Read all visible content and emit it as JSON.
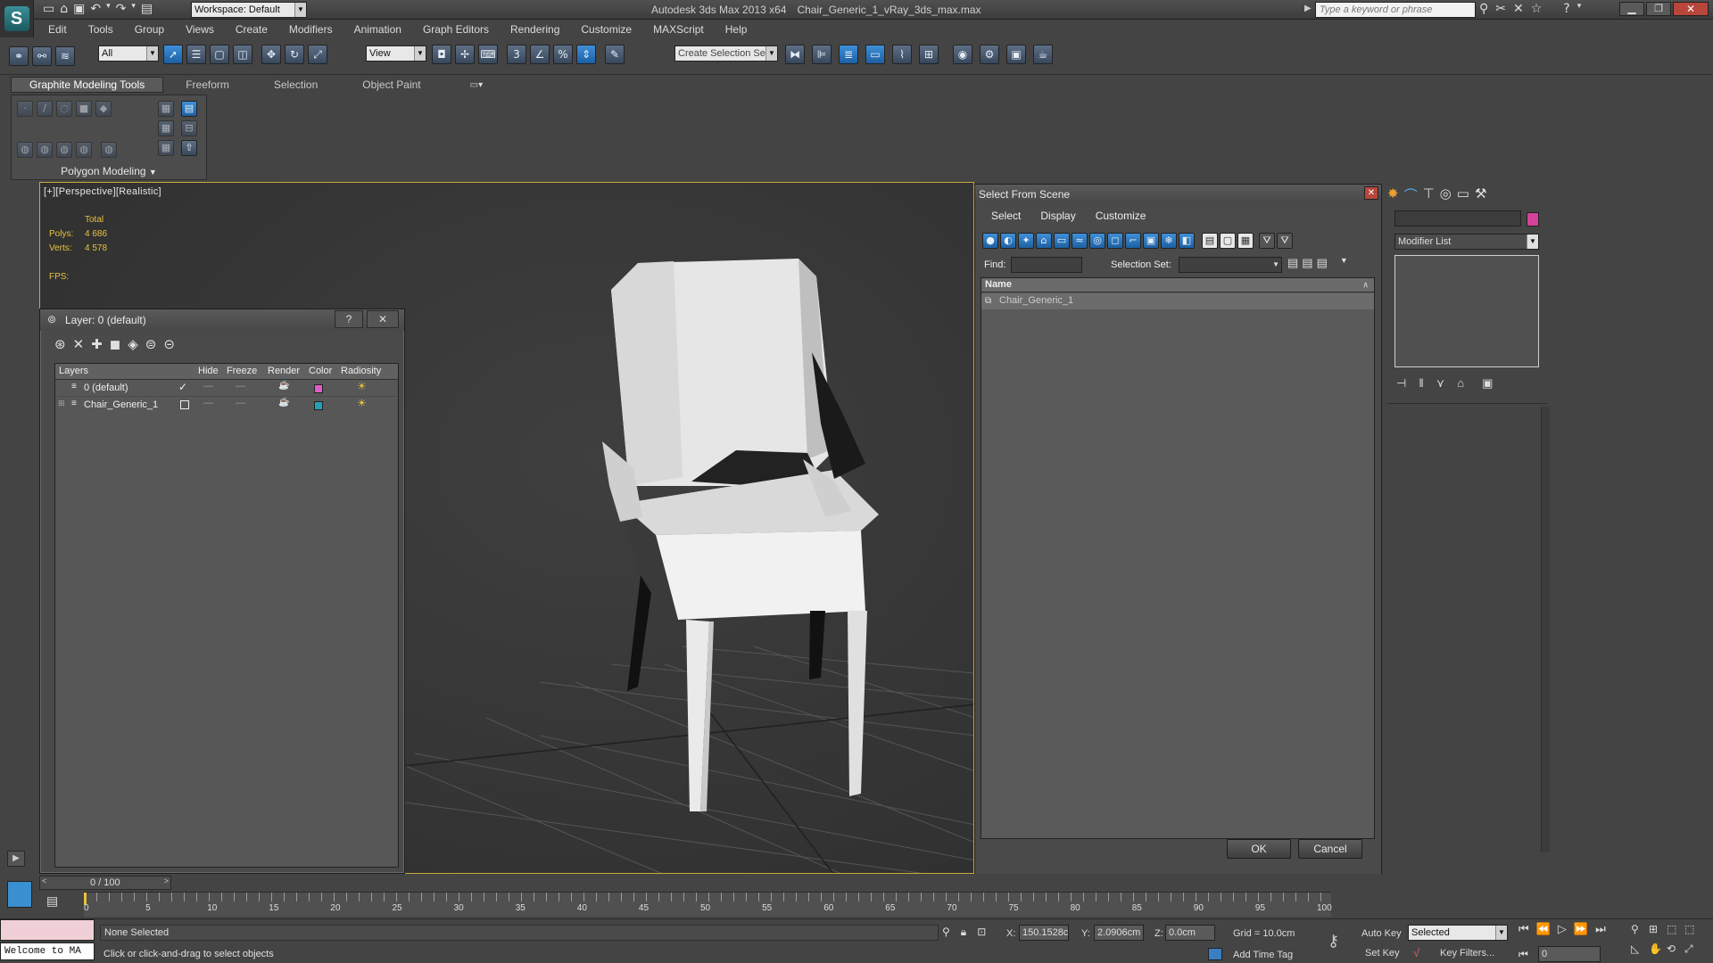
{
  "titlebar": {
    "workspace": "Workspace: Default",
    "app": "Autodesk 3ds Max  2013 x64",
    "file": "Chair_Generic_1_vRay_3ds_max.max",
    "search_placeholder": "Type a keyword or phrase"
  },
  "menu": [
    "Edit",
    "Tools",
    "Group",
    "Views",
    "Create",
    "Modifiers",
    "Animation",
    "Graph Editors",
    "Rendering",
    "Customize",
    "MAXScript",
    "Help"
  ],
  "toolbar": {
    "filter": "All",
    "refcoord": "View",
    "selset": "Create Selection Se"
  },
  "ribbon": {
    "tabs": [
      "Graphite Modeling Tools",
      "Freeform",
      "Selection",
      "Object Paint"
    ],
    "panel": "Polygon Modeling"
  },
  "viewport": {
    "label": "[+][Perspective][Realistic]",
    "stats": {
      "total": "Total",
      "polys_label": "Polys:",
      "polys": "4 686",
      "verts_label": "Verts:",
      "verts": "4 578",
      "fps_label": "FPS:"
    }
  },
  "layer_dialog": {
    "title": "Layer: 0 (default)",
    "help": "?",
    "columns": [
      "Layers",
      "Hide",
      "Freeze",
      "Render",
      "Color",
      "Radiosity"
    ],
    "rows": [
      {
        "name": "0 (default)",
        "color": "#e05cc8"
      },
      {
        "name": "Chair_Generic_1",
        "color": "#22a0b8"
      }
    ]
  },
  "select_dialog": {
    "title": "Select From Scene",
    "menu": [
      "Select",
      "Display",
      "Customize"
    ],
    "find_label": "Find:",
    "find_value": "",
    "selset_label": "Selection Set:",
    "column": "Name",
    "items": [
      "Chair_Generic_1"
    ],
    "ok": "OK",
    "cancel": "Cancel"
  },
  "command_panel": {
    "modifier_list": "Modifier List",
    "color": "#d6419a"
  },
  "timeline": {
    "frame": "0 / 100",
    "ticks": [
      "0",
      "5",
      "10",
      "15",
      "20",
      "25",
      "30",
      "35",
      "40",
      "45",
      "50",
      "55",
      "60",
      "65",
      "70",
      "75",
      "80",
      "85",
      "90",
      "95",
      "100"
    ]
  },
  "status": {
    "welcome": "Welcome to MA",
    "selected": "None Selected",
    "prompt": "Click or click-and-drag to select objects",
    "x_label": "X:",
    "x": "150.1528c",
    "y_label": "Y:",
    "y": "2.0906cm",
    "z_label": "Z:",
    "z": "0.0cm",
    "grid": "Grid = 10.0cm",
    "add_time_tag": "Add Time Tag",
    "auto_key": "Auto Key",
    "set_key": "Set Key",
    "key_mode": "Selected",
    "key_filters": "Key Filters...",
    "frame": "0"
  },
  "colors": {
    "accent": "#e8c23a",
    "bg": "#444444",
    "viewport": "#3a3a3a",
    "layer_pink": "#e05cc8",
    "layer_cyan": "#22a0b8",
    "object_color": "#d6419a"
  }
}
